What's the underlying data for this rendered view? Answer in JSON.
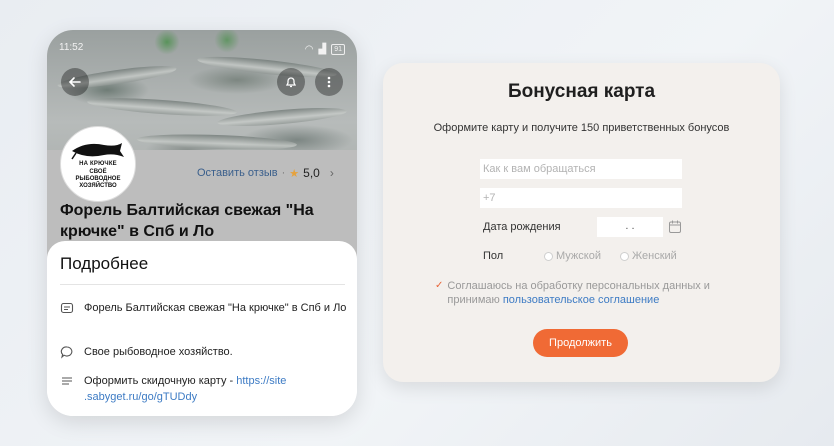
{
  "phone": {
    "status": {
      "time": "11:52",
      "battery": "91"
    },
    "logo": {
      "brand": "НА КРЮЧКЕ",
      "text_line1": "СВОЁ",
      "text_line2": "РЫБОВОДНОЕ",
      "text_line3": "ХОЗЯЙСТВО"
    },
    "review": {
      "link": "Оставить отзыв",
      "separator": "·",
      "rating": "5,0"
    },
    "company_title": "Форель Балтийская свежая \"На крючке\" в Спб и Ло",
    "sheet": {
      "title": "Подробнее",
      "rows": [
        {
          "icon": "card-icon",
          "text": "Форель Балтийская свежая \"На крючке\" в Спб и Ло"
        },
        {
          "icon": "comment-icon",
          "text": "Свое рыбоводное хозяйство."
        },
        {
          "icon": "lines-icon",
          "text": "Оформить скидочную карту - ",
          "link": "https://site .sabyget.ru/go/gTUDdy"
        }
      ]
    }
  },
  "card": {
    "title": "Бонусная карта",
    "subtitle": "Оформите карту и получите 150 приветственных бонусов",
    "name_placeholder": "Как к вам обращаться",
    "phone_placeholder": "+7",
    "birth_label": "Дата рождения",
    "date_value": ".   .",
    "gender_label": "Пол",
    "male": "Мужской",
    "female": "Женский",
    "agree_text": "Соглашаюсь на обработку персональных данных и принимаю",
    "agree_link": "пользовательское соглашение",
    "submit": "Продолжить",
    "accent": "#f06a35"
  }
}
